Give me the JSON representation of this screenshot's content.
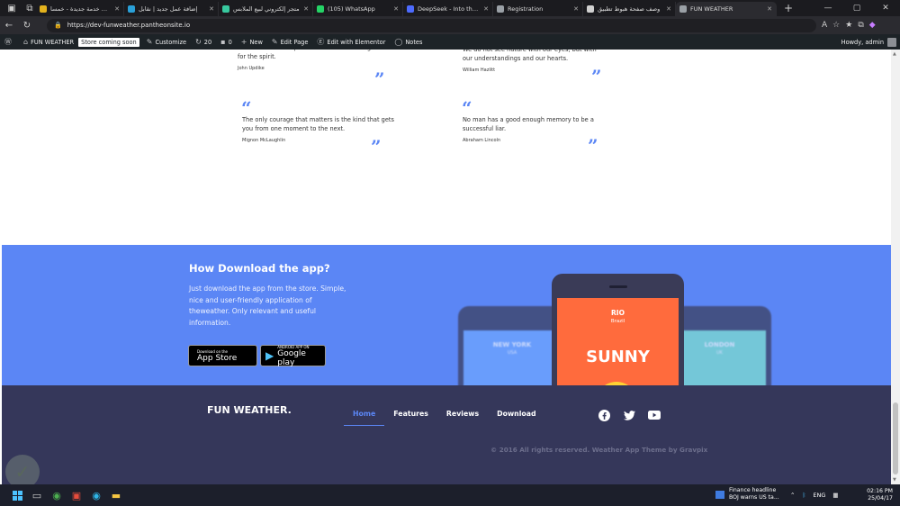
{
  "browser": {
    "tabs": [
      {
        "title": "أضف خدمة جديدة - خمسا",
        "favicon_color": "#e3b21d",
        "active": false
      },
      {
        "title": "إضافة عمل جديد | نقابل",
        "favicon_color": "#2aa0d8",
        "active": false
      },
      {
        "title": "متجر إلكتروني لبيع الملابس",
        "favicon_color": "#38c99f",
        "active": false
      },
      {
        "title": "(105) WhatsApp",
        "favicon_color": "#25d366",
        "active": false
      },
      {
        "title": "DeepSeek - Into the Unkn",
        "favicon_color": "#4d6bfe",
        "active": false
      },
      {
        "title": "Registration",
        "favicon_color": "#9aa0a6",
        "active": false
      },
      {
        "title": "وصف صفحة هبوط تطبيق",
        "favicon_color": "#d0d0d0",
        "active": false
      },
      {
        "title": "FUN WEATHER",
        "favicon_color": "#9aa0a6",
        "active": true
      }
    ],
    "url": "https://dev-funweather.pantheonsite.io"
  },
  "wp_admin_bar": {
    "site_name": "FUN WEATHER",
    "badge": "Store coming soon",
    "customize": "Customize",
    "updates": "20",
    "comments": "0",
    "new": "New",
    "edit_page": "Edit Page",
    "edit_elementor": "Edit with Elementor",
    "notes": "Notes",
    "howdy": "Howdy, admin"
  },
  "quotes": [
    {
      "text": "What art offers is space - a certain breathing room for the spirit.",
      "author": "John Updike"
    },
    {
      "text": "We do not see nature with our eyes, but with our understandings and our hearts.",
      "author": "William Hazlitt"
    },
    {
      "text": "The only courage that matters is the kind that gets you from one moment to the next.",
      "author": "Mignon McLaughlin"
    },
    {
      "text": "No man has a good enough memory to be a successful liar.",
      "author": "Abraham Lincoln"
    }
  ],
  "download": {
    "title": "How Download the app?",
    "text": "Just download the app from the store. Simple, nice and user-friendly application of theweather. Only relevant and useful information.",
    "app_store": {
      "small": "Download on the",
      "big": "App Store"
    },
    "google_play": {
      "small": "ANDROID APP ON",
      "big": "Google play"
    },
    "phone_center": {
      "city": "RIO",
      "country": "Brazil",
      "weather": "SUNNY"
    },
    "phone_left": {
      "city": "NEW YORK",
      "country": "USA"
    },
    "phone_right": {
      "city": "LONDON",
      "country": "UK"
    }
  },
  "footer": {
    "brand": "FUN WEATHER.",
    "nav": [
      "Home",
      "Features",
      "Reviews",
      "Download"
    ],
    "copyright": "© 2016 All rights reserved. Weather App Theme by Gravpix"
  },
  "taskbar": {
    "news_title": "Finance headline",
    "news_text": "BOJ warns US ta...",
    "lang": "ENG",
    "time": "02:16 PM",
    "date": "25/04/17"
  },
  "colors": {
    "accent": "#5b86f5",
    "footer": "#35375a",
    "phone_orange": "#ff6b3d"
  }
}
